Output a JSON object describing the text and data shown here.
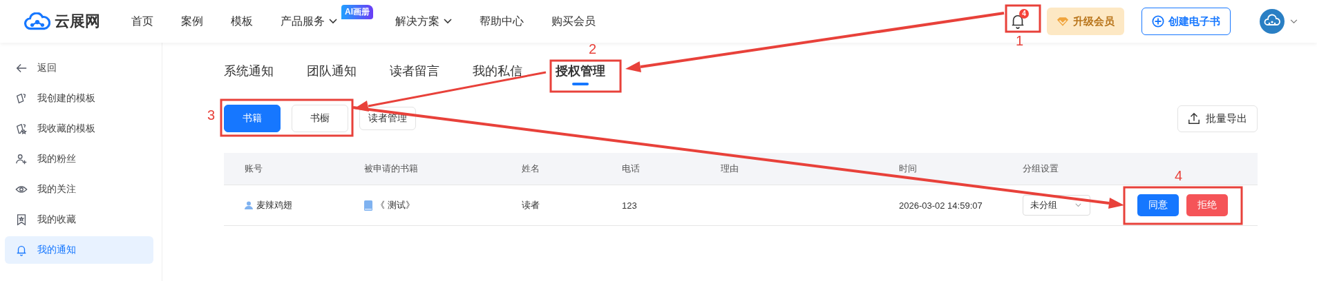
{
  "header": {
    "logo": "云展网",
    "nav": [
      {
        "label": "首页",
        "dropdown": false
      },
      {
        "label": "案例",
        "dropdown": false
      },
      {
        "label": "模板",
        "dropdown": false
      },
      {
        "label": "产品服务",
        "dropdown": true,
        "badge": "AI画册"
      },
      {
        "label": "解决方案",
        "dropdown": true
      },
      {
        "label": "帮助中心",
        "dropdown": false
      },
      {
        "label": "购买会员",
        "dropdown": false
      }
    ],
    "notification_count": "4",
    "upgrade_button": "升级会员",
    "create_button": "创建电子书"
  },
  "sidebar": {
    "back": "返回",
    "items": [
      {
        "label": "我创建的模板",
        "selected": false
      },
      {
        "label": "我收藏的模板",
        "selected": false
      },
      {
        "label": "我的粉丝",
        "selected": false
      },
      {
        "label": "我的关注",
        "selected": false
      },
      {
        "label": "我的收藏",
        "selected": false
      },
      {
        "label": "我的通知",
        "selected": true
      }
    ]
  },
  "tabs": [
    {
      "label": "系统通知",
      "selected": false
    },
    {
      "label": "团队通知",
      "selected": false
    },
    {
      "label": "读者留言",
      "selected": false
    },
    {
      "label": "我的私信",
      "selected": false
    },
    {
      "label": "授权管理",
      "selected": true
    }
  ],
  "sub_tabs": [
    {
      "label": "书籍",
      "selected": true
    },
    {
      "label": "书橱",
      "selected": false
    },
    {
      "label": "读者管理",
      "selected": false
    }
  ],
  "export_button": "批量导出",
  "table": {
    "columns": [
      "账号",
      "被申请的书籍",
      "姓名",
      "电话",
      "理由",
      "时间",
      "分组设置"
    ],
    "rows": [
      {
        "account": "麦辣鸡翅",
        "book": "《 测试》",
        "name": "读者",
        "phone": "123",
        "time": "2026-03-02 14:59:07",
        "group": "未分组",
        "actions": [
          "同意",
          "拒绝"
        ]
      }
    ]
  },
  "annotations": [
    "1",
    "2",
    "3",
    "4"
  ]
}
